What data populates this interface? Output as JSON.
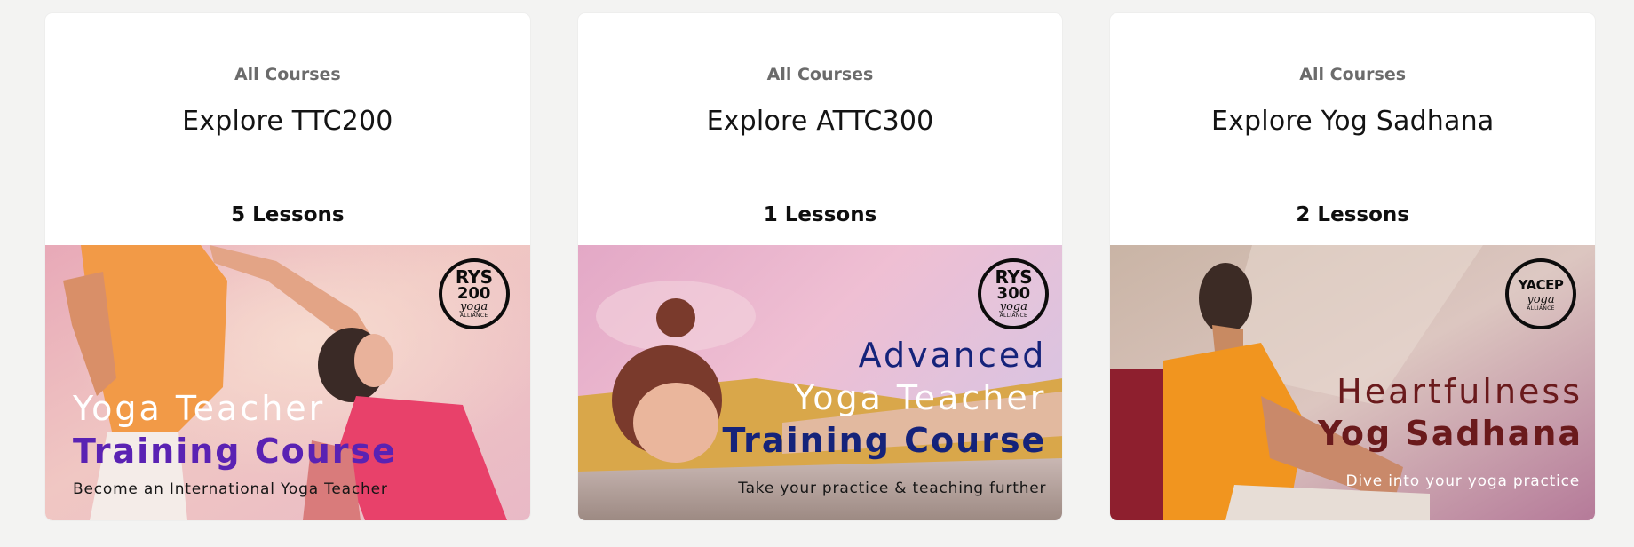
{
  "cards": [
    {
      "eyebrow": "All Courses",
      "title": "Explore TTC200",
      "lessons": "5 Lessons",
      "badge": {
        "line1": "RYS",
        "line2": "200",
        "line3": "yoga",
        "line4": "ALLIANCE"
      },
      "banner": {
        "line1": "Yoga Teacher",
        "line2": "Training Course",
        "tagline": "Become an International Yoga Teacher",
        "accent_color": "#5a22b3"
      }
    },
    {
      "eyebrow": "All Courses",
      "title": "Explore ATTC300",
      "lessons": "1 Lessons",
      "badge": {
        "line1": "RYS",
        "line2": "300",
        "line3": "yoga",
        "line4": "ALLIANCE"
      },
      "banner": {
        "line0": "Advanced",
        "line1": "Yoga Teacher",
        "line2": "Training Course",
        "tagline": "Take your practice & teaching further",
        "accent_color": "#15237a"
      }
    },
    {
      "eyebrow": "All Courses",
      "title": "Explore Yog Sadhana",
      "lessons": "2 Lessons",
      "badge": {
        "line1": "YACEP",
        "line3": "yoga",
        "line4": "ALLIANCE"
      },
      "banner": {
        "line1": "Heartfulness",
        "line2": "Yog Sadhana",
        "tagline": "Dive into your yoga practice",
        "accent_color": "#6a1a1c"
      }
    }
  ]
}
